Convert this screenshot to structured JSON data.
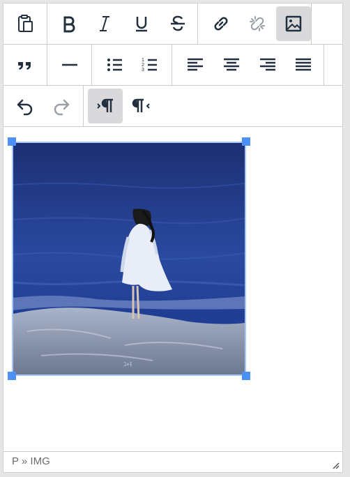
{
  "toolbar": {
    "row1": [
      "paste",
      "bold",
      "italic",
      "underline",
      "strikethrough",
      "link",
      "unlink",
      "image"
    ],
    "row2": [
      "blockquote",
      "horizontal-rule",
      "bulleted-list",
      "numbered-list",
      "align-left",
      "align-center",
      "align-right",
      "justify"
    ],
    "row3": [
      "undo",
      "redo",
      "ltr",
      "rtl"
    ],
    "active": [
      "image",
      "ltr"
    ]
  },
  "icons": {
    "ordered_list_digits": [
      "1",
      "2",
      "3"
    ]
  },
  "content": {
    "image": {
      "subject": "woman in white dress on rocky shore by blue sea",
      "watermark": "ｺ+ﾓ"
    }
  },
  "statusbar": {
    "path": "P » IMG"
  },
  "colors": {
    "selection_handle": "#4a90f5",
    "selection_border": "#a6c8ff",
    "active_button": "#d9d9dc",
    "icon": "#222f3e",
    "icon_disabled": "#9aa0a6"
  }
}
